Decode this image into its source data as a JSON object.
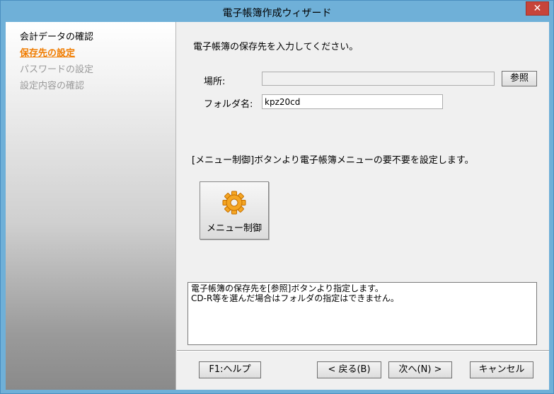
{
  "window": {
    "title": "電子帳簿作成ウィザード",
    "close_label": "✕"
  },
  "sidebar": {
    "steps": [
      {
        "label": "会計データの確認",
        "state": "done"
      },
      {
        "label": "保存先の設定",
        "state": "current"
      },
      {
        "label": "パスワードの設定",
        "state": "pending"
      },
      {
        "label": "設定内容の確認",
        "state": "pending"
      }
    ]
  },
  "main": {
    "instruction": "電子帳簿の保存先を入力してください。",
    "location_label": "場所:",
    "location_value": "",
    "browse_label": "参照",
    "folder_label": "フォルダ名:",
    "folder_value": "kpz20cd",
    "menu_description": "[メニュー制御]ボタンより電子帳簿メニューの要不要を設定します。",
    "menu_button_label": "メニュー制御",
    "menu_button_icon": "gear-icon",
    "help_text": "電子帳簿の保存先を[参照]ボタンより指定します。\nCD-R等を選んだ場合はフォルダの指定はできません。"
  },
  "footer": {
    "help_label": "F1:ヘルプ",
    "back_label": "< 戻る(B)",
    "next_label": "次へ(N) >",
    "cancel_label": "キャンセル"
  },
  "colors": {
    "current_step": "#f07c00",
    "pending_step": "#9a9a9a",
    "titlebar": "#6fb0d8",
    "close_button": "#c7443a",
    "gear": "#f5a623"
  }
}
